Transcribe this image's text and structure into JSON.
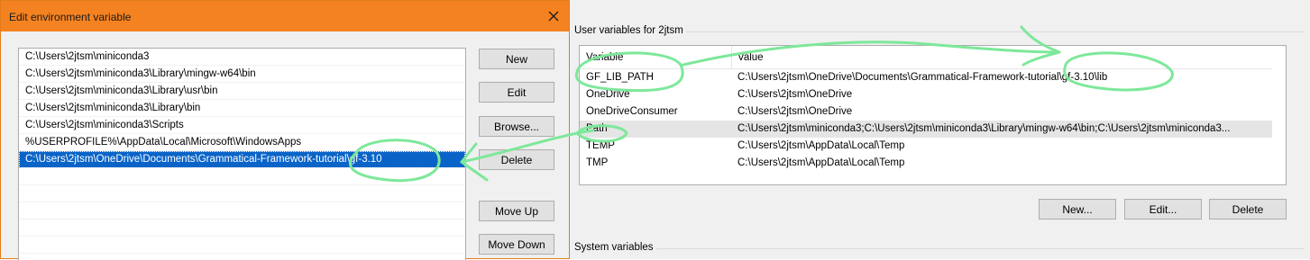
{
  "dialog": {
    "title": "Edit environment variable",
    "close_icon": "close-icon",
    "path_entries": [
      "C:\\Users\\2jtsm\\miniconda3",
      "C:\\Users\\2jtsm\\miniconda3\\Library\\mingw-w64\\bin",
      "C:\\Users\\2jtsm\\miniconda3\\Library\\usr\\bin",
      "C:\\Users\\2jtsm\\miniconda3\\Library\\bin",
      "C:\\Users\\2jtsm\\miniconda3\\Scripts",
      "%USERPROFILE%\\AppData\\Local\\Microsoft\\WindowsApps",
      "C:\\Users\\2jtsm\\OneDrive\\Documents\\Grammatical-Framework-tutorial\\gf-3.10"
    ],
    "selected_index": 6,
    "buttons": {
      "new": "New",
      "edit": "Edit",
      "browse": "Browse...",
      "delete": "Delete",
      "move_up": "Move Up",
      "move_down": "Move Down"
    }
  },
  "env_panel": {
    "user_group_label": "User variables for 2jtsm",
    "system_group_label": "System variables",
    "columns": [
      "Variable",
      "Value"
    ],
    "user_vars": [
      {
        "name": "GF_LIB_PATH",
        "value": "C:\\Users\\2jtsm\\OneDrive\\Documents\\Grammatical-Framework-tutorial\\gf-3.10\\lib"
      },
      {
        "name": "OneDrive",
        "value": "C:\\Users\\2jtsm\\OneDrive"
      },
      {
        "name": "OneDriveConsumer",
        "value": "C:\\Users\\2jtsm\\OneDrive"
      },
      {
        "name": "Path",
        "value": "C:\\Users\\2jtsm\\miniconda3;C:\\Users\\2jtsm\\miniconda3\\Library\\mingw-w64\\bin;C:\\Users\\2jtsm\\miniconda3..."
      },
      {
        "name": "TEMP",
        "value": "C:\\Users\\2jtsm\\AppData\\Local\\Temp"
      },
      {
        "name": "TMP",
        "value": "C:\\Users\\2jtsm\\AppData\\Local\\Temp"
      }
    ],
    "selected_row": 3,
    "buttons": {
      "new": "New...",
      "edit": "Edit...",
      "delete": "Delete"
    }
  },
  "annotation_color": "#7de89a"
}
